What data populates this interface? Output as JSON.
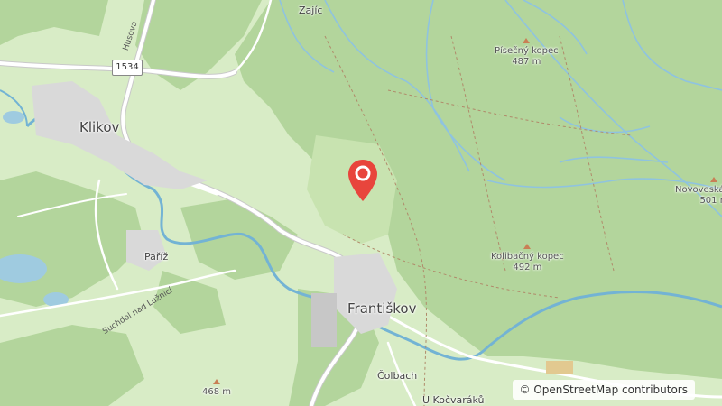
{
  "map": {
    "labels": {
      "zajic": "Zajíc",
      "klikov": "Klikov",
      "pariz": "Paříž",
      "frantiskov": "Františkov",
      "colbach": "Čolbach",
      "u_kocvaraku": "U Kočvaráků",
      "husova": "Husova",
      "suchdol": "Suchdol nad Lužnicí"
    },
    "road_shield": "1534",
    "peaks": [
      {
        "name": "Písečný kopec",
        "elevation": "487 m"
      },
      {
        "name": "Novoveská brána",
        "elevation": "501 m"
      },
      {
        "name": "Kolibačný kopec",
        "elevation": "492 m"
      },
      {
        "name": "",
        "elevation": "468 m"
      }
    ],
    "attribution": "© OpenStreetMap contributors",
    "colors": {
      "forest": "#b3d59c",
      "meadow": "#d8ecc6",
      "water": "#73b3d4",
      "road": "#ffffff",
      "marker": "#e8453c"
    }
  }
}
